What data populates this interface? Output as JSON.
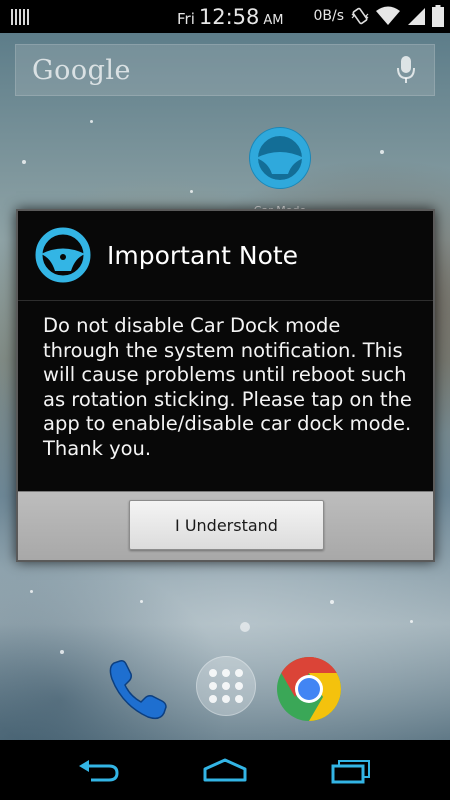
{
  "status_bar": {
    "day": "Fri",
    "time": "12:58",
    "ampm": "AM",
    "net_speed": "0B/s",
    "icons": [
      "barcode-icon",
      "vibrate-icon",
      "wifi-icon",
      "signal-icon",
      "battery-icon"
    ]
  },
  "search": {
    "logo_text": "Google",
    "mic_icon": "mic-icon"
  },
  "home_app": {
    "label": "Car Mode",
    "icon": "steering-wheel-icon"
  },
  "dialog": {
    "icon": "steering-wheel-icon",
    "title": "Important Note",
    "message": "Do not disable Car Dock mode through the system notification. This will cause problems until reboot such as rotation sticking. Please tap on the app to enable/disable car dock mode. Thank you.",
    "button_label": "I Understand"
  },
  "dock": {
    "icons": [
      "phone-icon",
      "app-drawer-icon",
      "chrome-icon"
    ]
  },
  "nav": {
    "icons": [
      "back-icon",
      "home-icon",
      "recent-apps-icon"
    ]
  },
  "colors": {
    "accent": "#33b5e5",
    "dialog_bg": "#080808",
    "button_bar": "#b4b4b4"
  }
}
